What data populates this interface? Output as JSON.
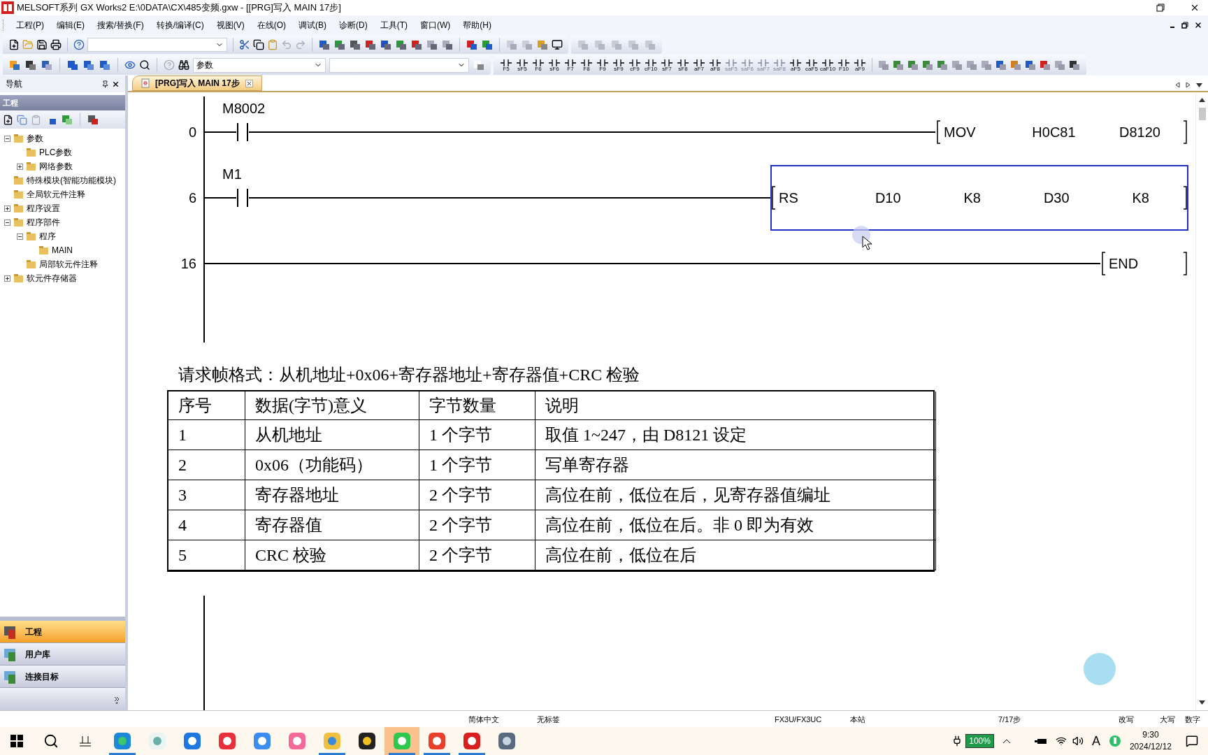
{
  "window": {
    "title": "MELSOFT系列 GX Works2 E:\\0DATA\\CX\\485变频.gxw - [[PRG]写入 MAIN 17步]"
  },
  "menu": [
    "工程(P)",
    "编辑(E)",
    "搜索/替换(F)",
    "转换/编译(C)",
    "视图(V)",
    "在线(O)",
    "调试(B)",
    "诊断(D)",
    "工具(T)",
    "窗口(W)",
    "帮助(H)"
  ],
  "toolbar_2": {
    "combo": "参数",
    "keys": [
      {
        "label": "F5",
        "disabled": false
      },
      {
        "label": "sF5",
        "disabled": false
      },
      {
        "label": "F6",
        "disabled": false
      },
      {
        "label": "sF6",
        "disabled": false
      },
      {
        "label": "F7",
        "disabled": false
      },
      {
        "label": "F8",
        "disabled": false
      },
      {
        "label": "F9",
        "disabled": false
      },
      {
        "label": "sF9",
        "disabled": false
      },
      {
        "label": "cF9",
        "disabled": false
      },
      {
        "label": "cF10",
        "disabled": false
      },
      {
        "label": "sF7",
        "disabled": false
      },
      {
        "label": "sF8",
        "disabled": false
      },
      {
        "label": "aF7",
        "disabled": false
      },
      {
        "label": "aF8",
        "disabled": false
      },
      {
        "label": "saF5",
        "disabled": true
      },
      {
        "label": "saF6",
        "disabled": true
      },
      {
        "label": "saF7",
        "disabled": true
      },
      {
        "label": "saF8",
        "disabled": true
      },
      {
        "label": "aF5",
        "disabled": false
      },
      {
        "label": "caF5",
        "disabled": false
      },
      {
        "label": "caF10",
        "disabled": false
      },
      {
        "label": "F10",
        "disabled": false
      },
      {
        "label": "aF9",
        "disabled": false
      }
    ]
  },
  "navigation": {
    "title": "导航",
    "section": "工程",
    "tree": [
      {
        "label": "参数",
        "expanded": true,
        "children": [
          {
            "label": "PLC参数"
          },
          {
            "label": "网络参数",
            "expanded": false
          }
        ]
      },
      {
        "label": "特殊模块(智能功能模块)"
      },
      {
        "label": "全局软元件注释"
      },
      {
        "label": "程序设置",
        "expanded": false
      },
      {
        "label": "程序部件",
        "expanded": true,
        "children": [
          {
            "label": "程序",
            "expanded": true,
            "children": [
              {
                "label": "MAIN"
              }
            ]
          },
          {
            "label": "局部软元件注释"
          }
        ]
      },
      {
        "label": "软元件存储器",
        "expanded": false
      }
    ],
    "bottom_tabs": [
      {
        "label": "工程",
        "selected": true
      },
      {
        "label": "用户库",
        "selected": false
      },
      {
        "label": "连接目标",
        "selected": false
      }
    ]
  },
  "document_tab": {
    "label": "[PRG]写入 MAIN 17步"
  },
  "ladder": {
    "rungs": [
      {
        "step": "0",
        "contact": "M8002",
        "instruction": [
          "MOV",
          "H0C81",
          "D8120"
        ],
        "selected": false
      },
      {
        "step": "6",
        "contact": "M1",
        "instruction": [
          "RS",
          "D10",
          "K8",
          "D30",
          "K8"
        ],
        "selected": true
      },
      {
        "step": "16",
        "instruction": [
          "END"
        ],
        "selected": false
      }
    ]
  },
  "frame_table": {
    "caption": "请求帧格式：从机地址+0x06+寄存器地址+寄存器值+CRC 检验",
    "columns": [
      "序号",
      "数据(字节)意义",
      "字节数量",
      "说明"
    ],
    "rows": [
      [
        "1",
        "从机地址",
        "1 个字节",
        "取值 1~247，由 D8121 设定"
      ],
      [
        "2",
        "0x06（功能码）",
        "1 个字节",
        "写单寄存器"
      ],
      [
        "3",
        "寄存器地址",
        "2 个字节",
        "高位在前，低位在后，见寄存器值编址"
      ],
      [
        "4",
        "寄存器值",
        "2 个字节",
        "高位在前，低位在后。非 0 即为有效"
      ],
      [
        "5",
        "CRC 校验",
        "2 个字节",
        "高位在前，低位在后"
      ]
    ]
  },
  "status_bar": [
    "简体中文",
    "无标签",
    "FX3U/FX3UC",
    "本站",
    "7/17步",
    "改写",
    "大写",
    "数字"
  ],
  "taskbar": {
    "apps": [
      {
        "kind": "edge",
        "running": true,
        "selected": false
      },
      {
        "kind": "swirl",
        "running": false,
        "selected": false
      },
      {
        "kind": "triangle",
        "running": false,
        "selected": false
      },
      {
        "kind": "music",
        "running": false,
        "selected": false
      },
      {
        "kind": "bird",
        "running": false,
        "selected": false
      },
      {
        "kind": "video",
        "running": false,
        "selected": false
      },
      {
        "kind": "folder",
        "running": true,
        "selected": false
      },
      {
        "kind": "penguin",
        "running": false,
        "selected": false
      },
      {
        "kind": "chat",
        "running": true,
        "selected": true
      },
      {
        "kind": "office",
        "running": true,
        "selected": false
      },
      {
        "kind": "plc",
        "running": true,
        "selected": false
      },
      {
        "kind": "calculator",
        "running": false,
        "selected": false
      }
    ],
    "battery": "100%",
    "ime": "A",
    "time": "9:30",
    "date": "2024/12/12"
  }
}
